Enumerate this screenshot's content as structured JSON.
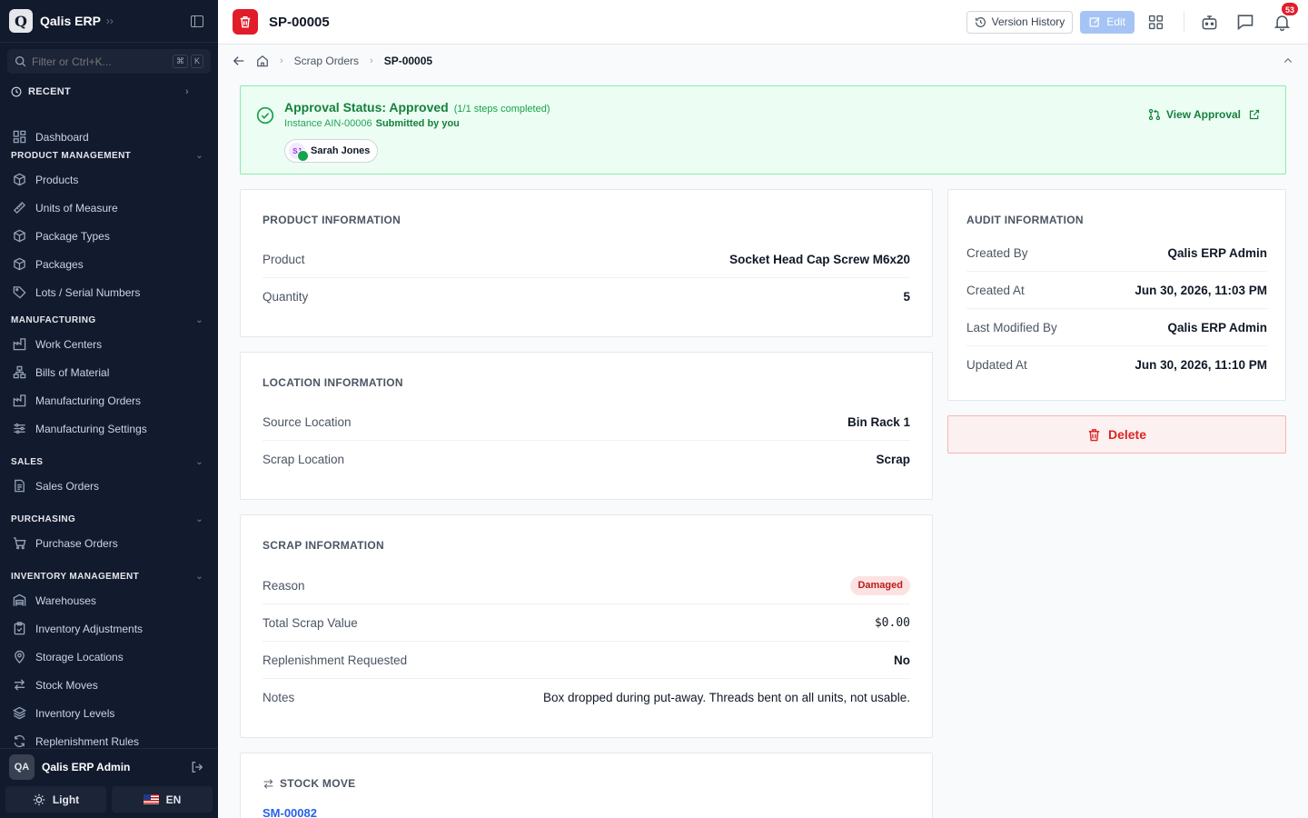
{
  "app": {
    "logo_letter": "Q",
    "name": "Qalis ERP"
  },
  "search": {
    "placeholder": "Filter or Ctrl+K...",
    "kbd1": "⌘",
    "kbd2": "K"
  },
  "recent_label": "RECENT",
  "nav": {
    "dashboard": "Dashboard",
    "sections": {
      "product": "PRODUCT MANAGEMENT",
      "manufacturing": "MANUFACTURING",
      "sales": "SALES",
      "purchasing": "PURCHASING",
      "inventory": "INVENTORY MANAGEMENT"
    },
    "items": {
      "products": "Products",
      "uom": "Units of Measure",
      "package_types": "Package Types",
      "packages": "Packages",
      "lots": "Lots / Serial Numbers",
      "work_centers": "Work Centers",
      "bom": "Bills of Material",
      "mo": "Manufacturing Orders",
      "mfg_settings": "Manufacturing Settings",
      "sales_orders": "Sales Orders",
      "purchase_orders": "Purchase Orders",
      "warehouses": "Warehouses",
      "inv_adjust": "Inventory Adjustments",
      "storage": "Storage Locations",
      "stock_moves": "Stock Moves",
      "inv_levels": "Inventory Levels",
      "replenish": "Replenishment Rules"
    }
  },
  "user": {
    "initials": "QA",
    "name": "Qalis ERP Admin"
  },
  "footer": {
    "theme": "Light",
    "lang": "EN"
  },
  "header": {
    "title": "SP-00005",
    "version_history": "Version History",
    "edit": "Edit",
    "notif_count": "53"
  },
  "breadcrumb": {
    "parent": "Scrap Orders",
    "current": "SP-00005"
  },
  "approval": {
    "title": "Approval Status: Approved",
    "steps": "(1/1 steps completed)",
    "instance": "Instance AIN-00006",
    "submitted": "Submitted by you",
    "approver_initials": "SJ",
    "approver": "Sarah Jones",
    "view": "View Approval"
  },
  "product_info": {
    "title": "PRODUCT INFORMATION",
    "rows": [
      {
        "label": "Product",
        "value": "Socket Head Cap Screw M6x20"
      },
      {
        "label": "Quantity",
        "value": "5"
      }
    ]
  },
  "location_info": {
    "title": "LOCATION INFORMATION",
    "rows": [
      {
        "label": "Source Location",
        "value": "Bin Rack 1"
      },
      {
        "label": "Scrap Location",
        "value": "Scrap"
      }
    ]
  },
  "scrap_info": {
    "title": "SCRAP INFORMATION",
    "reason_label": "Reason",
    "reason": "Damaged",
    "value_label": "Total Scrap Value",
    "value": "$0.00",
    "repl_label": "Replenishment Requested",
    "repl": "No",
    "notes_label": "Notes",
    "notes": "Box dropped during put-away. Threads bent on all units, not usable."
  },
  "audit": {
    "title": "AUDIT INFORMATION",
    "rows": [
      {
        "label": "Created By",
        "value": "Qalis ERP Admin"
      },
      {
        "label": "Created At",
        "value": "Jun 30, 2026, 11:03 PM"
      },
      {
        "label": "Last Modified By",
        "value": "Qalis ERP Admin"
      },
      {
        "label": "Updated At",
        "value": "Jun 30, 2026, 11:10 PM"
      }
    ]
  },
  "delete_label": "Delete",
  "stock_move": {
    "title": "STOCK MOVE",
    "link": "SM-00082"
  },
  "colors": {
    "accent_red": "#e11d2a",
    "approved_green": "#15803d",
    "sidebar_bg": "#121a2e",
    "link_blue": "#2563eb"
  }
}
